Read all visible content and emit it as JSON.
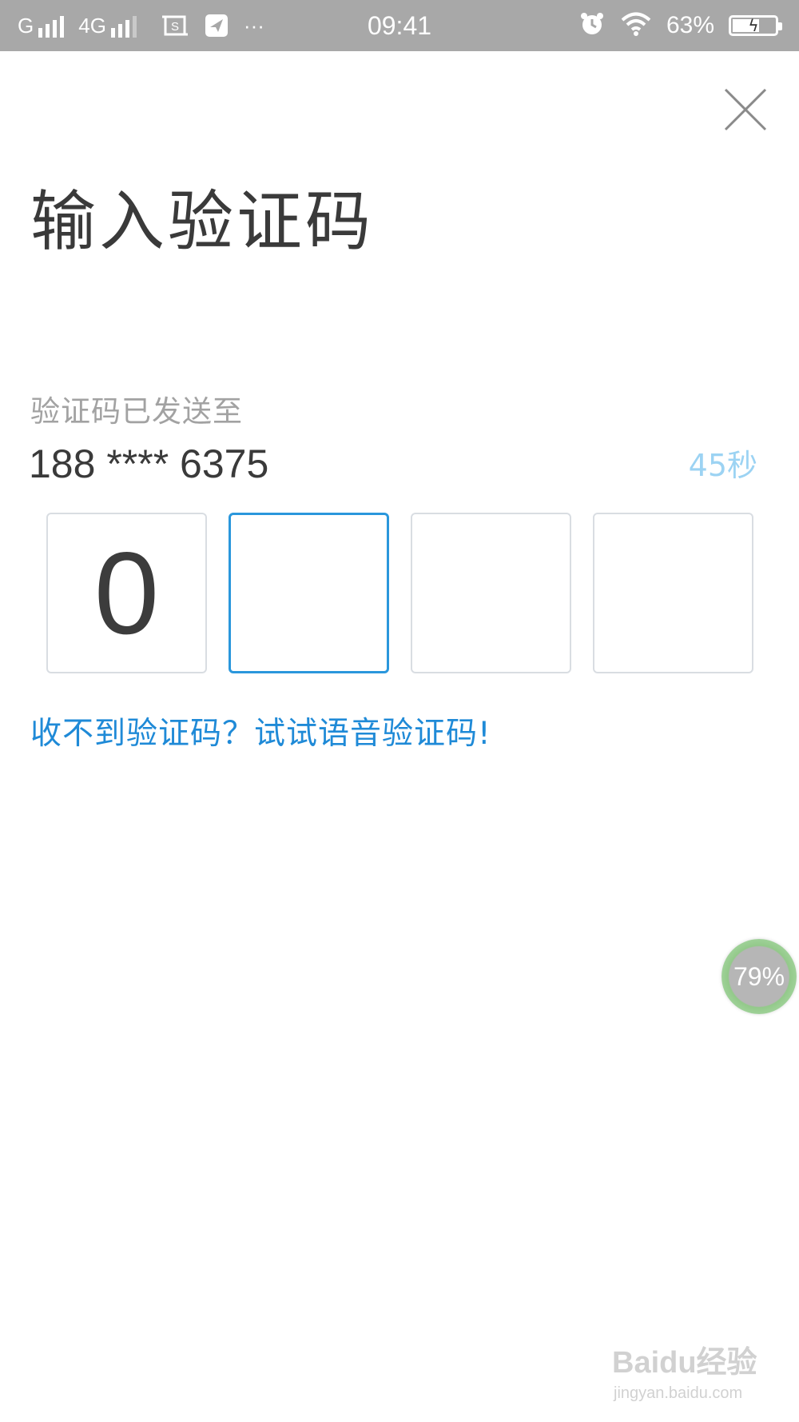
{
  "status_bar": {
    "carrier1": "G",
    "carrier2": "4G",
    "more": "···",
    "time": "09:41",
    "battery_percent": "63%",
    "battery_level": 0.63
  },
  "header": {
    "close_icon": "close-icon"
  },
  "main": {
    "title": "输入验证码",
    "sent_label": "验证码已发送至",
    "phone": "188 **** 6375",
    "countdown": "45秒",
    "code_digits": [
      "0",
      "",
      "",
      ""
    ],
    "active_index": 1,
    "voice_link": "收不到验证码？试试语音验证码!"
  },
  "float_widget": {
    "value": "79%"
  },
  "watermark": {
    "brand": "Baidu经验",
    "url": "jingyan.baidu.com"
  },
  "colors": {
    "accent": "#2a97dc",
    "link": "#1f8ad7",
    "countdown": "#9cd3f3",
    "status_bar": "#a8a8a8"
  }
}
